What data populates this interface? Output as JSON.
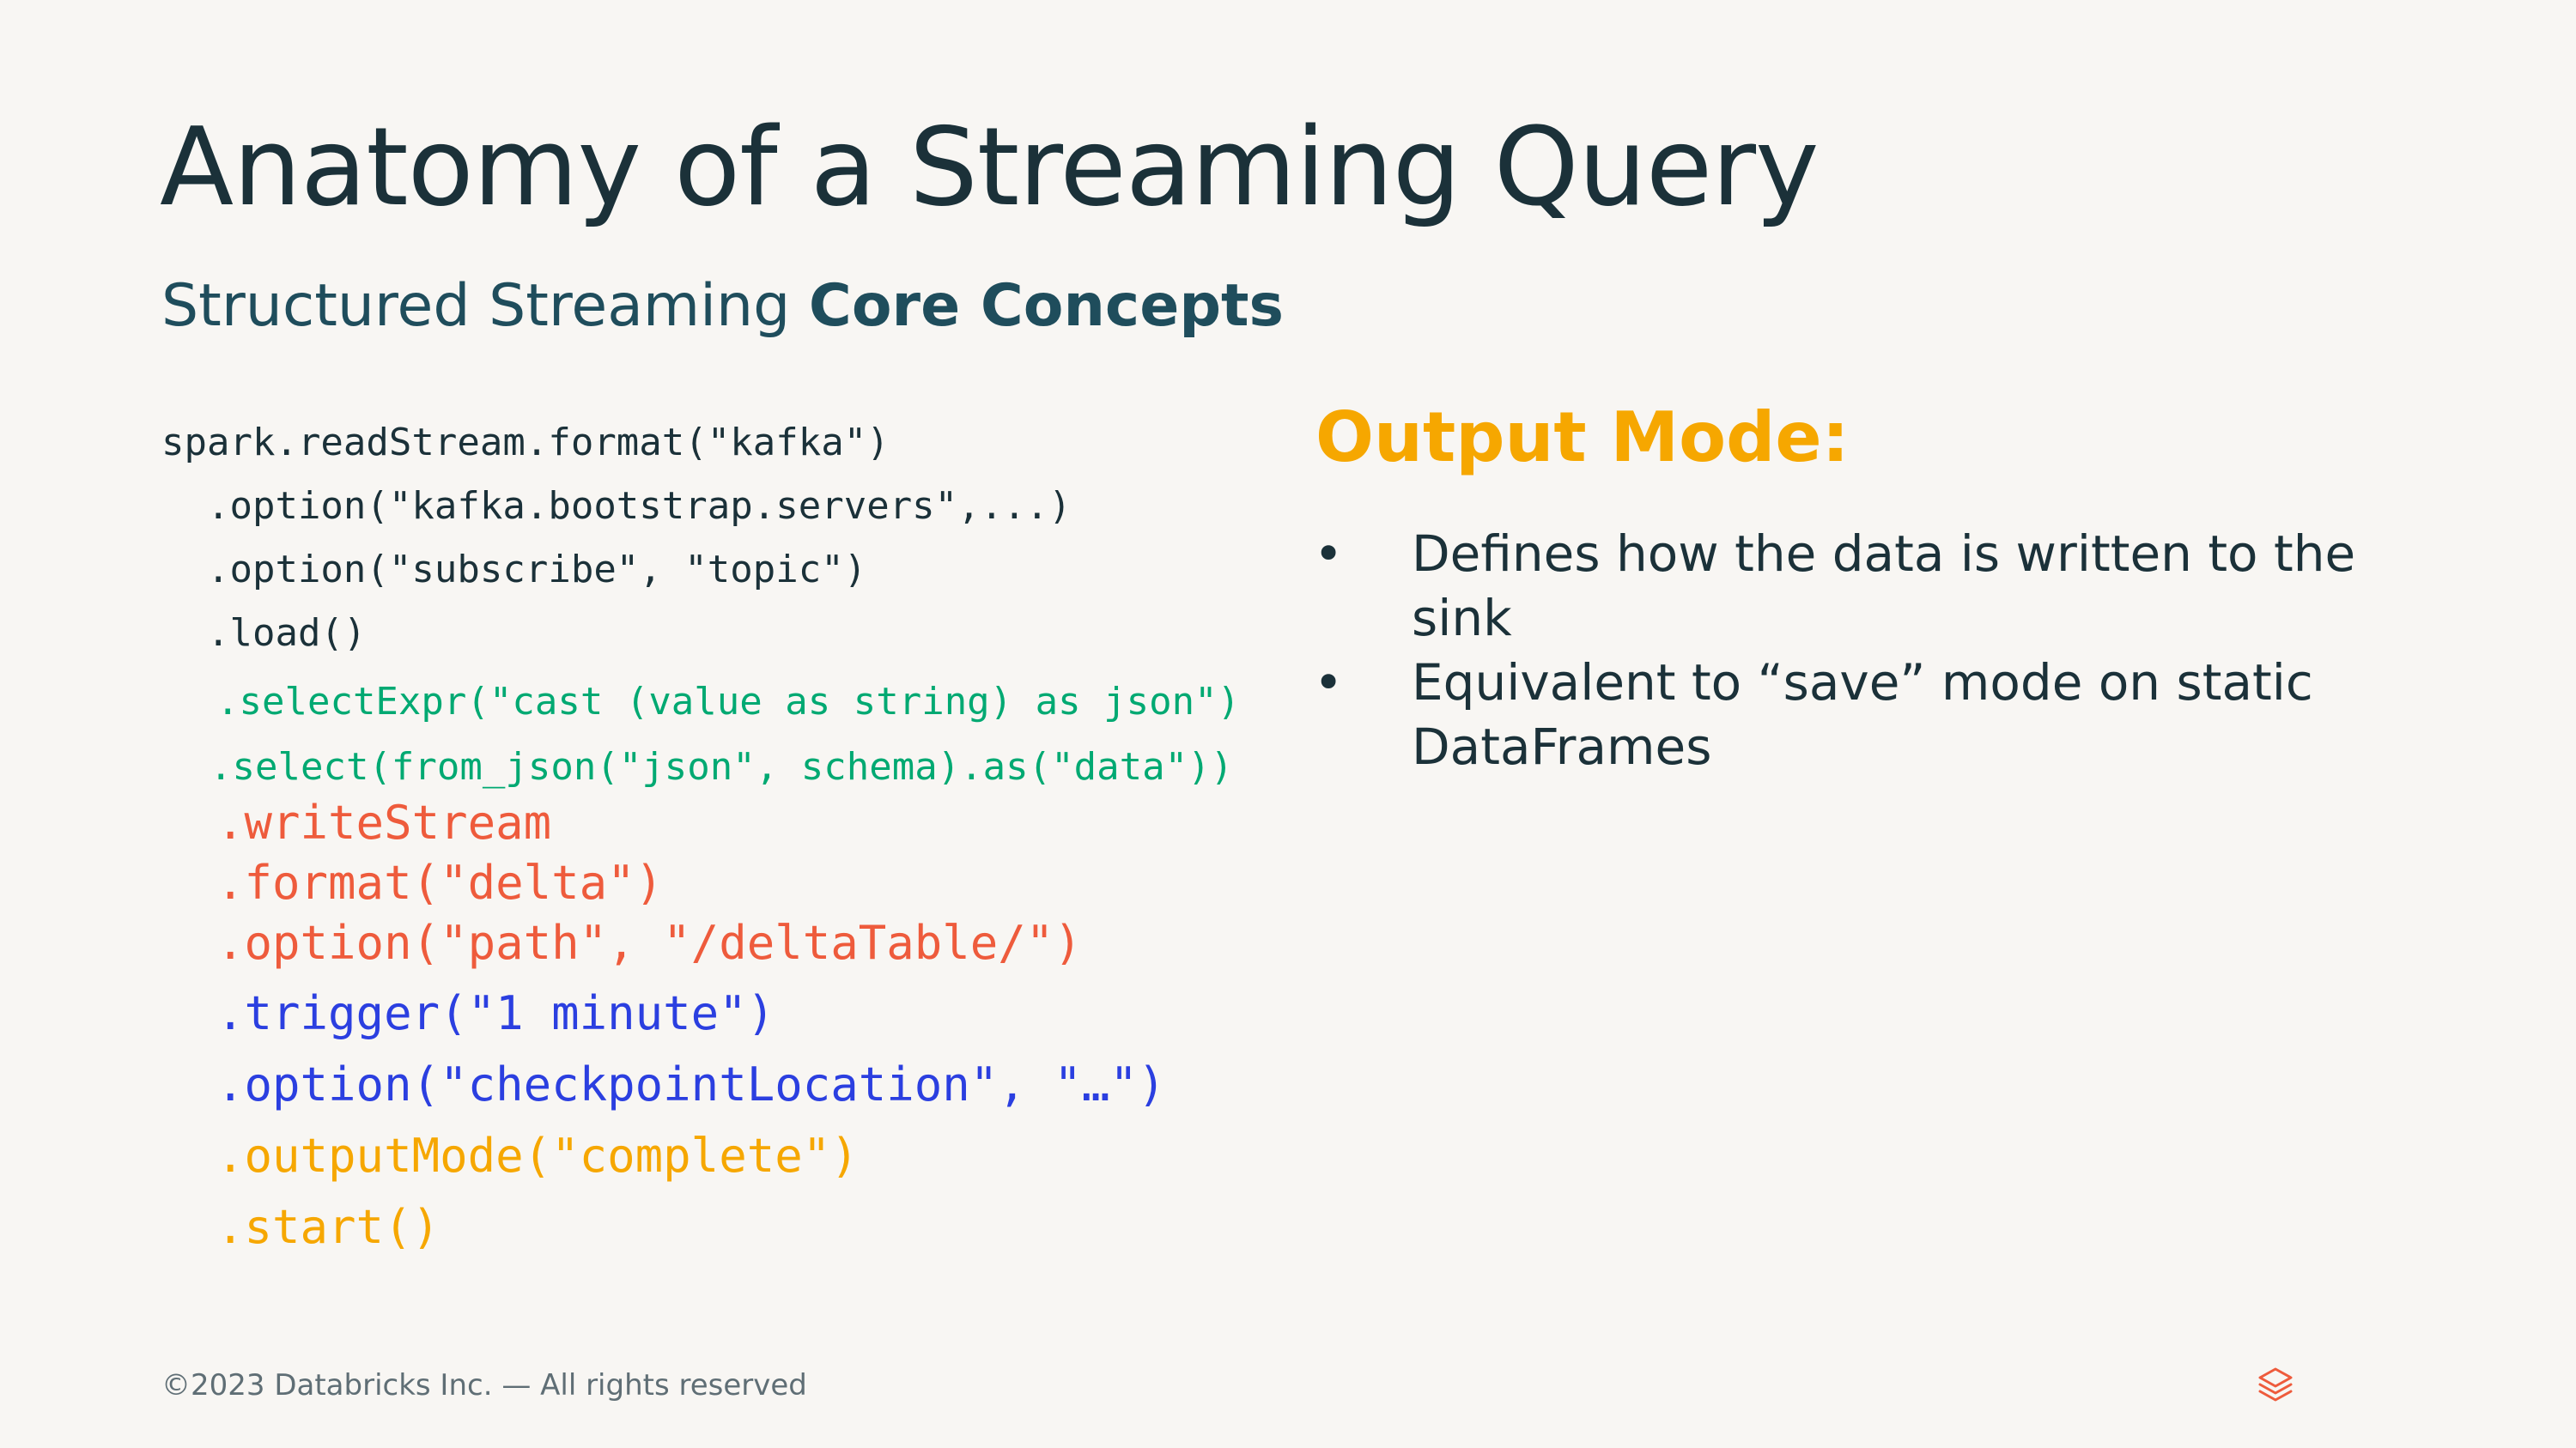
{
  "slide": {
    "title": "Anatomy of a Streaming Query",
    "subtitle_regular": "Structured Streaming ",
    "subtitle_bold": "Core Concepts"
  },
  "code": {
    "lines": [
      "spark.readStream.format(\"kafka\")",
      "  .option(\"kafka.bootstrap.servers\",...)",
      "  .option(\"subscribe\", \"topic\")",
      "  .load()",
      ".selectExpr(\"cast (value as string) as json\")",
      ".select(from_json(\"json\", schema).as(\"data\"))",
      ".writeStream",
      ".format(\"delta\")",
      ".option(\"path\", \"/deltaTable/\")",
      ".trigger(\"1 minute\")",
      ".option(\"checkpointLocation\", \"…\")",
      ".outputMode(\"complete\")",
      ".start()"
    ],
    "colors": {
      "source": "#1B3139",
      "transform": "#00A972",
      "sink": "#EE5B3C",
      "trigger": "#2B3FE0",
      "output_mode": "#F6A700"
    }
  },
  "output_mode": {
    "heading": "Output Mode:",
    "bullets": [
      "Defines how the data is written to the sink",
      "Equivalent to “save” mode on static DataFrames"
    ],
    "bullet_symbols": [
      "•",
      "•"
    ]
  },
  "footer": {
    "copyright": "©2023 Databricks Inc. — All rights reserved",
    "logo_icon": "databricks-logo-icon"
  }
}
